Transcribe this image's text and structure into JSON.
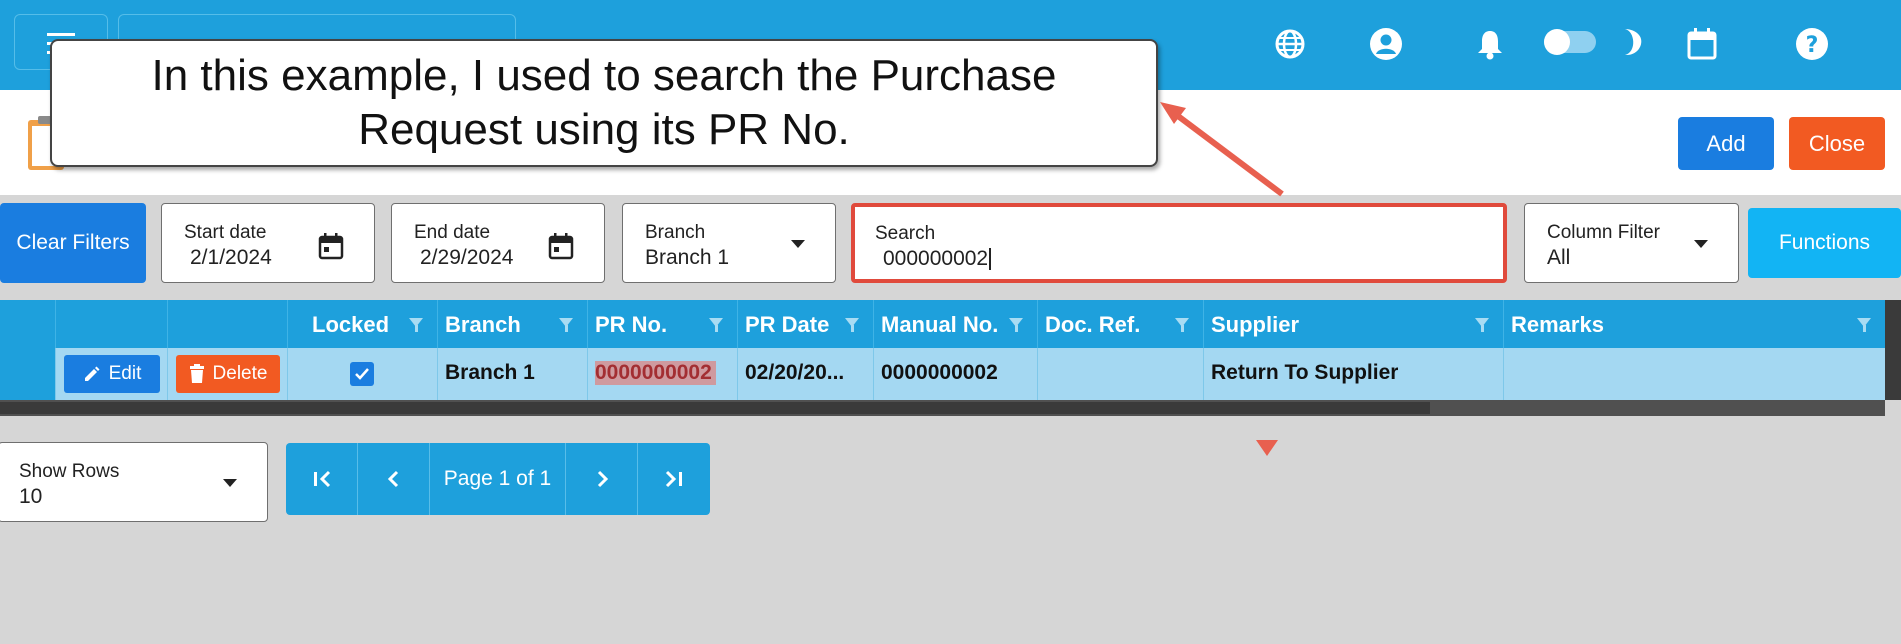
{
  "callout": {
    "text": "In this example, I used to search the Purchase Request using its PR No."
  },
  "topbar": {
    "icons": [
      "menu-icon",
      "globe-icon",
      "account-icon",
      "bell-icon",
      "theme-toggle",
      "moon-icon",
      "calendar-icon",
      "help-icon"
    ]
  },
  "header": {
    "add_label": "Add",
    "close_label": "Close"
  },
  "filters": {
    "clear_label": "Clear Filters",
    "start_date": {
      "label": "Start date",
      "value": "2/1/2024"
    },
    "end_date": {
      "label": "End date",
      "value": "2/29/2024"
    },
    "branch": {
      "label": "Branch",
      "value": "Branch 1"
    },
    "search": {
      "label": "Search",
      "value": "000000002"
    },
    "column_filter": {
      "label": "Column Filter",
      "value": "All"
    },
    "functions_label": "Functions"
  },
  "grid": {
    "columns": [
      "Locked",
      "Branch",
      "PR No.",
      "PR Date",
      "Manual No.",
      "Doc. Ref.",
      "Supplier",
      "Remarks"
    ],
    "rows": [
      {
        "edit_label": "Edit",
        "delete_label": "Delete",
        "locked": true,
        "branch": "Branch 1",
        "pr_no": "0000000002",
        "pr_date": "02/20/20...",
        "manual_no": "0000000002",
        "doc_ref": "",
        "supplier": "Return To Supplier",
        "remarks": ""
      }
    ]
  },
  "pager": {
    "show_rows_label": "Show Rows",
    "show_rows_value": "10",
    "page_text": "Page 1 of 1"
  },
  "colors": {
    "primary_bar": "#1ea0dc",
    "add_button": "#1a7de0",
    "close_button": "#f25a22",
    "highlight_border": "#e04a3c",
    "row_selected": "#a4d8f2"
  }
}
